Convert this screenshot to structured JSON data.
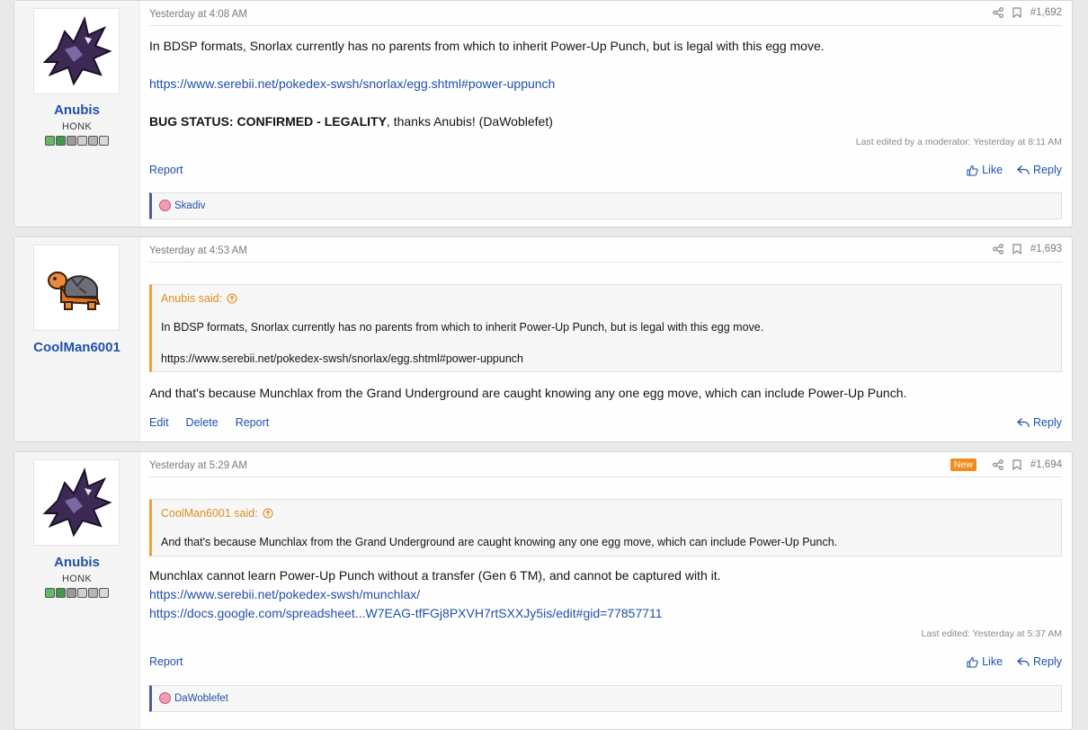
{
  "posts": [
    {
      "author": "Anubis",
      "user_title": "HONK",
      "date": "Yesterday at 4:08 AM",
      "post_number": "#1,692",
      "body_line1": "In BDSP formats, Snorlax currently has no parents from which to inherit Power-Up Punch, but is legal with this egg move.",
      "link1": "https://www.serebii.net/pokedex-swsh/snorlax/egg.shtml#power-uppunch",
      "status_bold": "BUG STATUS: CONFIRMED - LEGALITY",
      "status_rest": ", thanks Anubis! (DaWoblefet)",
      "edit_note": "Last edited by a moderator: Yesterday at 8:11 AM",
      "report": "Report",
      "like": "Like",
      "reply": "Reply",
      "reactor": "Skadiv"
    },
    {
      "author": "CoolMan6001",
      "date": "Yesterday at 4:53 AM",
      "post_number": "#1,693",
      "quote_author": "Anubis said:",
      "quote_line1": "In BDSP formats, Snorlax currently has no parents from which to inherit Power-Up Punch, but is legal with this egg move.",
      "quote_link": "https://www.serebii.net/pokedex-swsh/snorlax/egg.shtml#power-uppunch",
      "body_line1": "And that's because Munchlax from the Grand Underground are caught knowing any one egg move, which can include Power-Up Punch.",
      "edit": "Edit",
      "delete": "Delete",
      "report": "Report",
      "reply": "Reply"
    },
    {
      "author": "Anubis",
      "user_title": "HONK",
      "date": "Yesterday at 5:29 AM",
      "new_label": "New",
      "post_number": "#1,694",
      "quote_author": "CoolMan6001 said:",
      "quote_line1": "And that's because Munchlax from the Grand Underground are caught knowing any one egg move, which can include Power-Up Punch.",
      "body_line1": "Munchlax cannot learn Power-Up Punch without a transfer (Gen 6 TM), and cannot be captured with it.",
      "link1": "https://www.serebii.net/pokedex-swsh/munchlax/",
      "link2": "https://docs.google.com/spreadsheet...W7EAG-tfFGj8PXVH7rtSXXJy5is/edit#gid=77857711",
      "edit_note": "Last edited: Yesterday at 5:37 AM",
      "report": "Report",
      "like": "Like",
      "reply": "Reply",
      "reactor": "DaWoblefet"
    }
  ],
  "icons": {
    "share": "share-icon",
    "bookmark": "bookmark-icon",
    "like": "thumbs-up-icon",
    "reply": "reply-arrow-icon",
    "quote_jump": "arrow-up-circle-icon",
    "reaction": "heart-reaction-icon"
  },
  "colors": {
    "link": "#2150a8",
    "quote_accent": "#f0a035",
    "reaction_accent": "#4f5aa0",
    "new_badge": "#f08c1c"
  }
}
